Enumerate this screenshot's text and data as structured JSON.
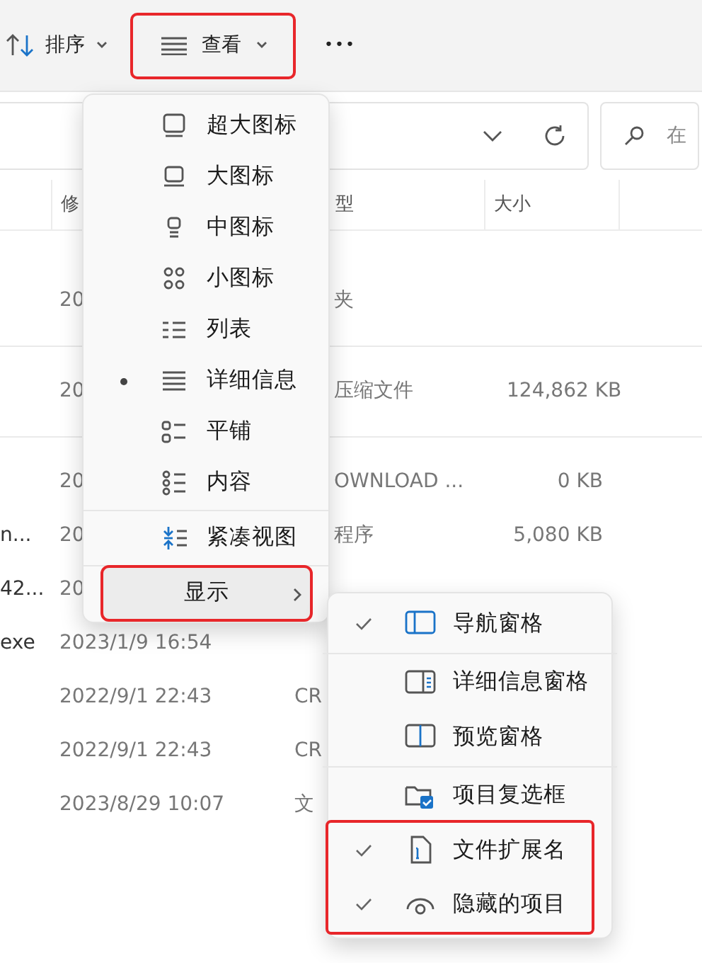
{
  "toolbar": {
    "sort": {
      "label": "排序"
    },
    "view": {
      "label": "查看",
      "highlighted": true
    },
    "more": {
      "label": "•••"
    }
  },
  "search": {
    "placeholder": "在"
  },
  "columns": [
    "修",
    "型",
    "大小"
  ],
  "rows": [
    {
      "kind": "spaced",
      "date": "20",
      "type": "夹",
      "clipped": true
    },
    {
      "kind": "spaced",
      "date": "20",
      "type": "压缩文件",
      "size": "124,862 KB",
      "clipped": true
    },
    {
      "kind": "plain",
      "date": "20",
      "type": "OWNLOAD ...",
      "size": "0 KB",
      "clipped": true
    },
    {
      "kind": "plain",
      "name": "n...",
      "date": "20",
      "type": "程序",
      "size": "5,080 KB",
      "clipped": true
    },
    {
      "kind": "plain",
      "name": "42...",
      "date": "20"
    },
    {
      "kind": "plain",
      "name": "exe",
      "date": "2023/1/9 16:54"
    },
    {
      "kind": "plain",
      "date": "2022/9/1 22:43",
      "type": "CR"
    },
    {
      "kind": "plain",
      "date": "2022/9/1 22:43",
      "type": "CR"
    },
    {
      "kind": "plain",
      "date": "2023/8/29 10:07",
      "type": "文"
    }
  ],
  "view_menu": {
    "sections": [
      {
        "items": [
          {
            "label": "超大图标",
            "selected": false
          },
          {
            "label": "大图标",
            "selected": false
          },
          {
            "label": "中图标",
            "selected": false
          },
          {
            "label": "小图标",
            "selected": false
          },
          {
            "label": "列表",
            "selected": false
          },
          {
            "label": "详细信息",
            "selected": true
          },
          {
            "label": "平铺",
            "selected": false
          },
          {
            "label": "内容",
            "selected": false
          }
        ]
      },
      {
        "items": [
          {
            "label": "紧凑视图",
            "selected": false
          }
        ]
      },
      {
        "items": [
          {
            "label": "显示",
            "kind": "submenu",
            "highlighted": true
          }
        ]
      }
    ]
  },
  "show_menu": {
    "sections": [
      {
        "highlighted": false,
        "items": [
          {
            "label": "导航窗格",
            "checked": true
          }
        ]
      },
      {
        "highlighted": false,
        "items": [
          {
            "label": "详细信息窗格",
            "checked": false
          },
          {
            "label": "预览窗格",
            "checked": false
          }
        ]
      },
      {
        "highlighted": false,
        "items": [
          {
            "label": "项目复选框",
            "checked": false
          }
        ]
      },
      {
        "highlighted": true,
        "items": [
          {
            "label": "文件扩展名",
            "checked": true
          },
          {
            "label": "隐藏的项目",
            "checked": true
          }
        ]
      }
    ]
  }
}
